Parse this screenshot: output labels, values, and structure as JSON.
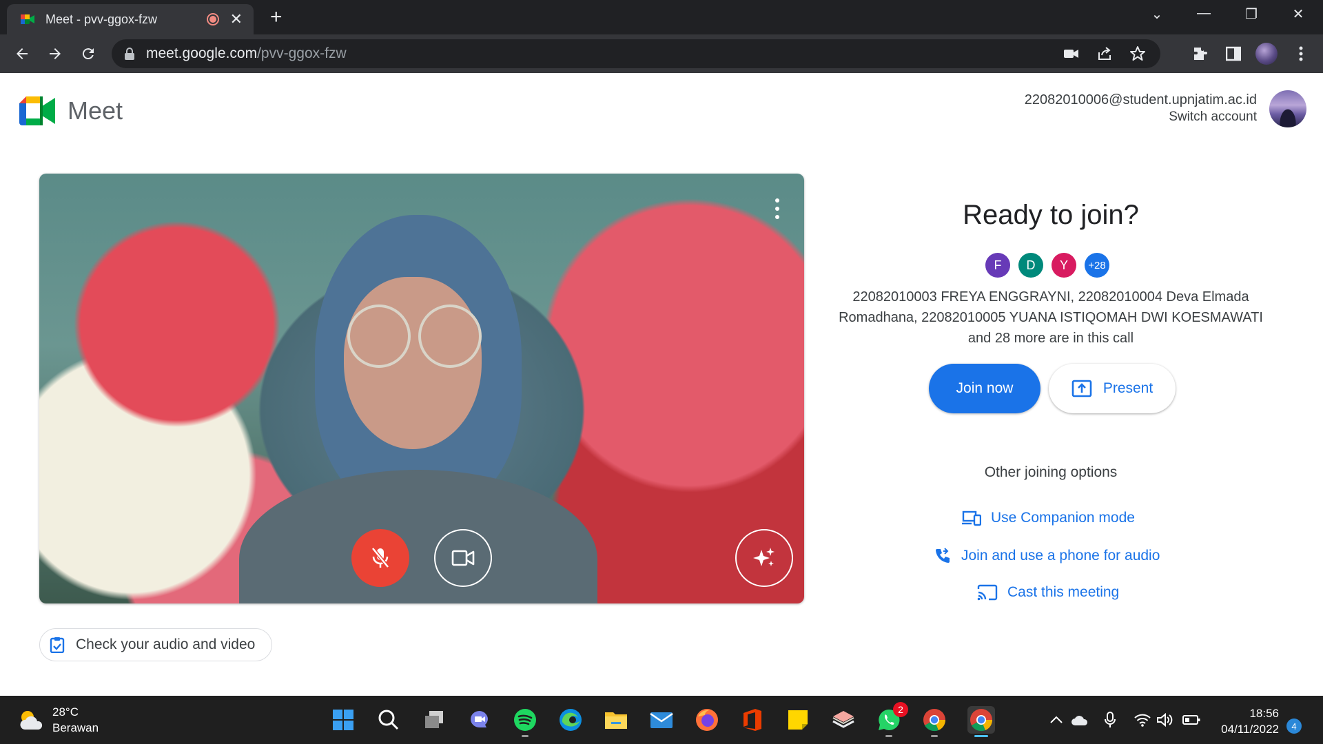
{
  "browser": {
    "tab_title": "Meet - pvv-ggox-fzw",
    "url_host": "meet.google.com",
    "url_path": "/pvv-ggox-fzw"
  },
  "header": {
    "app_name": "Meet",
    "account_email": "22082010006@student.upnjatim.ac.id",
    "switch_account": "Switch account"
  },
  "preview": {
    "check_av_label": "Check your audio and video",
    "mic_state": "muted",
    "camera_state": "on"
  },
  "join_panel": {
    "title": "Ready to join?",
    "avatars": [
      {
        "letter": "F",
        "color": "#673ab7"
      },
      {
        "letter": "D",
        "color": "#00897b"
      },
      {
        "letter": "Y",
        "color": "#d81b60"
      }
    ],
    "more_count": "+28",
    "in_call_text": "22082010003 FREYA ENGGRAYNI, 22082010004 Deva Elmada Romadhana, 22082010005 YUANA ISTIQOMAH DWI KOESMAWATI and 28 more are in this call",
    "join_label": "Join now",
    "present_label": "Present",
    "other_options_title": "Other joining options",
    "options": [
      {
        "label": "Use Companion mode",
        "icon": "companion-icon"
      },
      {
        "label": "Join and use a phone for audio",
        "icon": "phone-audio-icon"
      },
      {
        "label": "Cast this meeting",
        "icon": "cast-icon"
      }
    ]
  },
  "taskbar": {
    "temperature": "28°C",
    "weather": "Berawan",
    "time": "18:56",
    "date": "04/11/2022",
    "notification_count": "4",
    "whatsapp_badge": "2"
  }
}
